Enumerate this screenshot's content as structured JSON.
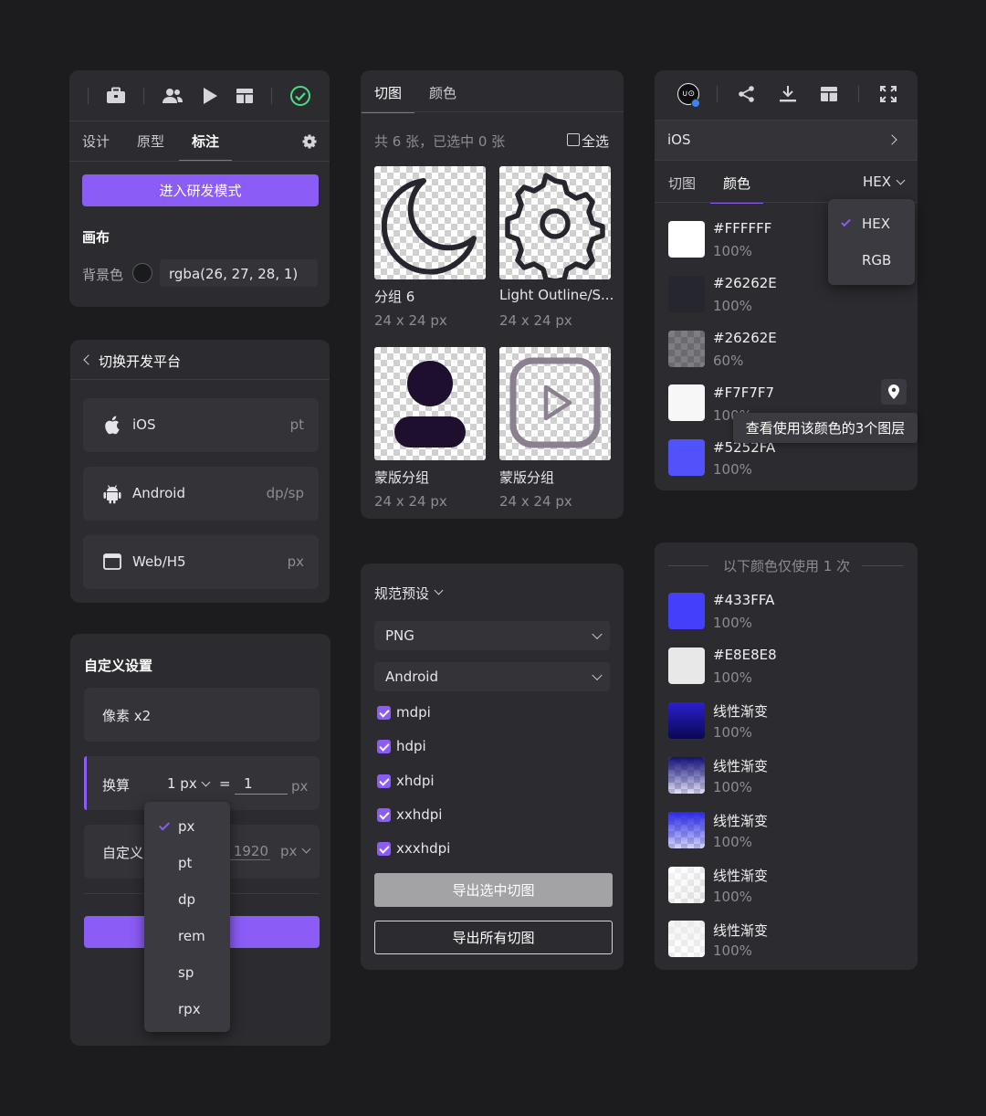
{
  "panel1": {
    "tabs": [
      "设计",
      "原型",
      "标注"
    ],
    "dev_mode_button": "进入研发模式",
    "canvas_heading": "画布",
    "bg_color_label": "背景色",
    "bg_color_value": "rgba(26, 27, 28, 1)"
  },
  "panel2": {
    "header": "切换开发平台",
    "platforms": [
      {
        "name": "iOS",
        "unit": "pt",
        "icon": "apple-icon"
      },
      {
        "name": "Android",
        "unit": "dp/sp",
        "icon": "android-icon"
      },
      {
        "name": "Web/H5",
        "unit": "px",
        "icon": "browser-icon"
      }
    ]
  },
  "panel3": {
    "heading": "自定义设置",
    "pixel_option": "像素 x2",
    "convert_label": "换算",
    "convert_from": "1 px",
    "equals": "=",
    "convert_value": "1",
    "convert_unit": "px",
    "custom_label": "自定义宽度",
    "custom_value": "1920",
    "custom_unit": "px",
    "unit_options": [
      "px",
      "pt",
      "dp",
      "rem",
      "sp",
      "rpx"
    ],
    "unit_selected": "px"
  },
  "panel4": {
    "tabs": [
      "切图",
      "颜色"
    ],
    "summary": "共 6 张，已选中 0 张",
    "select_all": "全选",
    "slices": [
      {
        "name": "分组 6",
        "size": "24 x 24 px",
        "icon": "moon-icon"
      },
      {
        "name": "Light Outline/S...",
        "size": "24 x 24 px",
        "icon": "settings-gear-icon"
      },
      {
        "name": "蒙版分组",
        "size": "24 x 24 px",
        "icon": "user-icon"
      },
      {
        "name": "蒙版分组",
        "size": "24 x 24 px",
        "icon": "play-square-icon"
      }
    ]
  },
  "panel5": {
    "preset_label": "规范预设",
    "format_value": "PNG",
    "platform_value": "Android",
    "densities": [
      "mdpi",
      "hdpi",
      "xhdpi",
      "xxhdpi",
      "xxxhdpi"
    ],
    "export_selected": "导出选中切图",
    "export_all": "导出所有切图"
  },
  "panel6": {
    "platform": "iOS",
    "tabs": [
      "切图",
      "颜色"
    ],
    "format": "HEX",
    "format_options": [
      "HEX",
      "RGB"
    ],
    "tooltip": "查看使用该颜色的3个图层",
    "colors": [
      {
        "hex": "#FFFFFF",
        "opacity": "100%",
        "swatch": "#ffffff"
      },
      {
        "hex": "#26262E",
        "opacity": "100%",
        "swatch": "#26262e"
      },
      {
        "hex": "#26262E",
        "opacity": "60%",
        "swatch": "#26262e"
      },
      {
        "hex": "#F7F7F7",
        "opacity": "100%",
        "swatch": "#f7f7f7"
      },
      {
        "hex": "#5252FA",
        "opacity": "100%",
        "swatch": "#5252fa"
      }
    ]
  },
  "panel7": {
    "header": "以下颜色仅使用 1 次",
    "colors": [
      {
        "name": "#433FFA",
        "opacity": "100%"
      },
      {
        "name": "#E8E8E8",
        "opacity": "100%"
      },
      {
        "name": "线性渐变",
        "opacity": "100%"
      },
      {
        "name": "线性渐变",
        "opacity": "100%"
      },
      {
        "name": "线性渐变",
        "opacity": "100%"
      },
      {
        "name": "线性渐变",
        "opacity": "100%"
      },
      {
        "name": "线性渐变",
        "opacity": "100%"
      }
    ]
  },
  "colors": {
    "accent": "#8b5cf6",
    "panel": "#2c2c30",
    "background": "#1c1c1e"
  }
}
